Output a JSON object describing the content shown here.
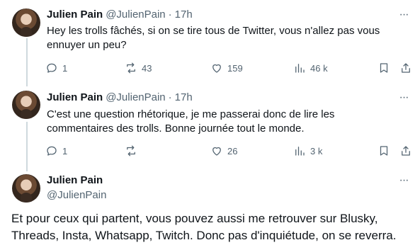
{
  "tweets": [
    {
      "name": "Julien Pain",
      "handle": "@JulienPain",
      "sep": "·",
      "time": "17h",
      "text_lines": [
        "Hey les trolls fâchés, si on se tire tous de Twitter, vous n'allez pas vous",
        "ennuyer un peu?"
      ],
      "replies": "1",
      "retweets": "43",
      "likes": "159",
      "views": "46 k"
    },
    {
      "name": "Julien Pain",
      "handle": "@JulienPain",
      "sep": "·",
      "time": "17h",
      "text_lines": [
        "C'est une question rhétorique, je me passerai donc de lire les",
        "commentaires des trolls. Bonne journée tout le monde."
      ],
      "replies": "1",
      "retweets": "",
      "likes": "26",
      "views": "3 k"
    },
    {
      "name": "Julien Pain",
      "handle": "@JulienPain",
      "text_lines": [
        "Et pour ceux qui partent, vous pouvez aussi me retrouver sur Blusky,",
        "Threads, Insta, Whatsapp, Twitch. Donc pas d'inquiétude, on se reverra."
      ]
    }
  ],
  "icons": {
    "more": "more-options-icon",
    "reply": "reply-icon",
    "retweet": "retweet-icon",
    "like": "heart-icon",
    "views": "views-chart-icon",
    "bookmark": "bookmark-icon",
    "share": "share-icon"
  }
}
